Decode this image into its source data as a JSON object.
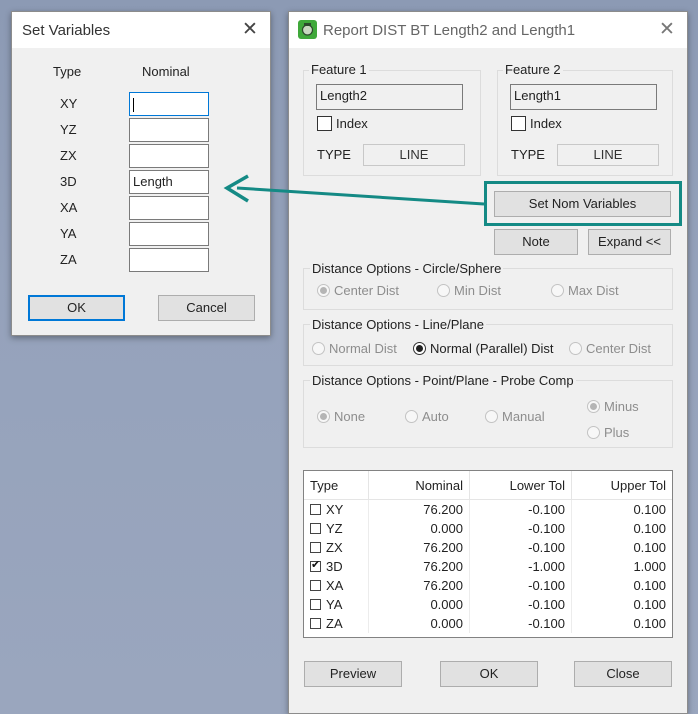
{
  "set_variables": {
    "title": "Set Variables",
    "col_type": "Type",
    "col_nominal": "Nominal",
    "rows": [
      {
        "type": "XY",
        "value": ""
      },
      {
        "type": "YZ",
        "value": ""
      },
      {
        "type": "ZX",
        "value": ""
      },
      {
        "type": "3D",
        "value": "Length"
      },
      {
        "type": "XA",
        "value": ""
      },
      {
        "type": "YA",
        "value": ""
      },
      {
        "type": "ZA",
        "value": ""
      }
    ],
    "ok_label": "OK",
    "cancel_label": "Cancel"
  },
  "report": {
    "title": "Report DIST BT Length2 and Length1",
    "feature1": {
      "label": "Feature 1",
      "value": "Length2",
      "index_label": "Index",
      "type_label": "TYPE",
      "type_value": "LINE"
    },
    "feature2": {
      "label": "Feature 2",
      "value": "Length1",
      "index_label": "Index",
      "type_label": "TYPE",
      "type_value": "LINE"
    },
    "set_nom_label": "Set Nom Variables",
    "note_label": "Note",
    "expand_label": "Expand <<",
    "circle": {
      "title": "Distance Options - Circle/Sphere",
      "opt1": "Center Dist",
      "opt2": "Min Dist",
      "opt3": "Max Dist"
    },
    "line": {
      "title": "Distance Options - Line/Plane",
      "opt1": "Normal Dist",
      "opt2": "Normal (Parallel) Dist",
      "opt3": "Center Dist"
    },
    "point": {
      "title": "Distance Options - Point/Plane - Probe Comp",
      "opt1": "None",
      "opt2": "Auto",
      "opt3": "Manual",
      "opt4": "Minus",
      "opt5": "Plus"
    },
    "table": {
      "headers": [
        "Type",
        "Nominal",
        "Lower Tol",
        "Upper Tol"
      ],
      "rows": [
        {
          "type": "XY",
          "checked": false,
          "nominal": "76.200",
          "lower": "-0.100",
          "upper": "0.100"
        },
        {
          "type": "YZ",
          "checked": false,
          "nominal": "0.000",
          "lower": "-0.100",
          "upper": "0.100"
        },
        {
          "type": "ZX",
          "checked": false,
          "nominal": "76.200",
          "lower": "-0.100",
          "upper": "0.100"
        },
        {
          "type": "3D",
          "checked": true,
          "nominal": "76.200",
          "lower": "-1.000",
          "upper": "1.000"
        },
        {
          "type": "XA",
          "checked": false,
          "nominal": "76.200",
          "lower": "-0.100",
          "upper": "0.100"
        },
        {
          "type": "YA",
          "checked": false,
          "nominal": "0.000",
          "lower": "-0.100",
          "upper": "0.100"
        },
        {
          "type": "ZA",
          "checked": false,
          "nominal": "0.000",
          "lower": "-0.100",
          "upper": "0.100"
        }
      ]
    },
    "preview_label": "Preview",
    "ok_label": "OK",
    "close_label": "Close"
  },
  "colors": {
    "annotation": "#148a85",
    "focus": "#0078d7"
  }
}
